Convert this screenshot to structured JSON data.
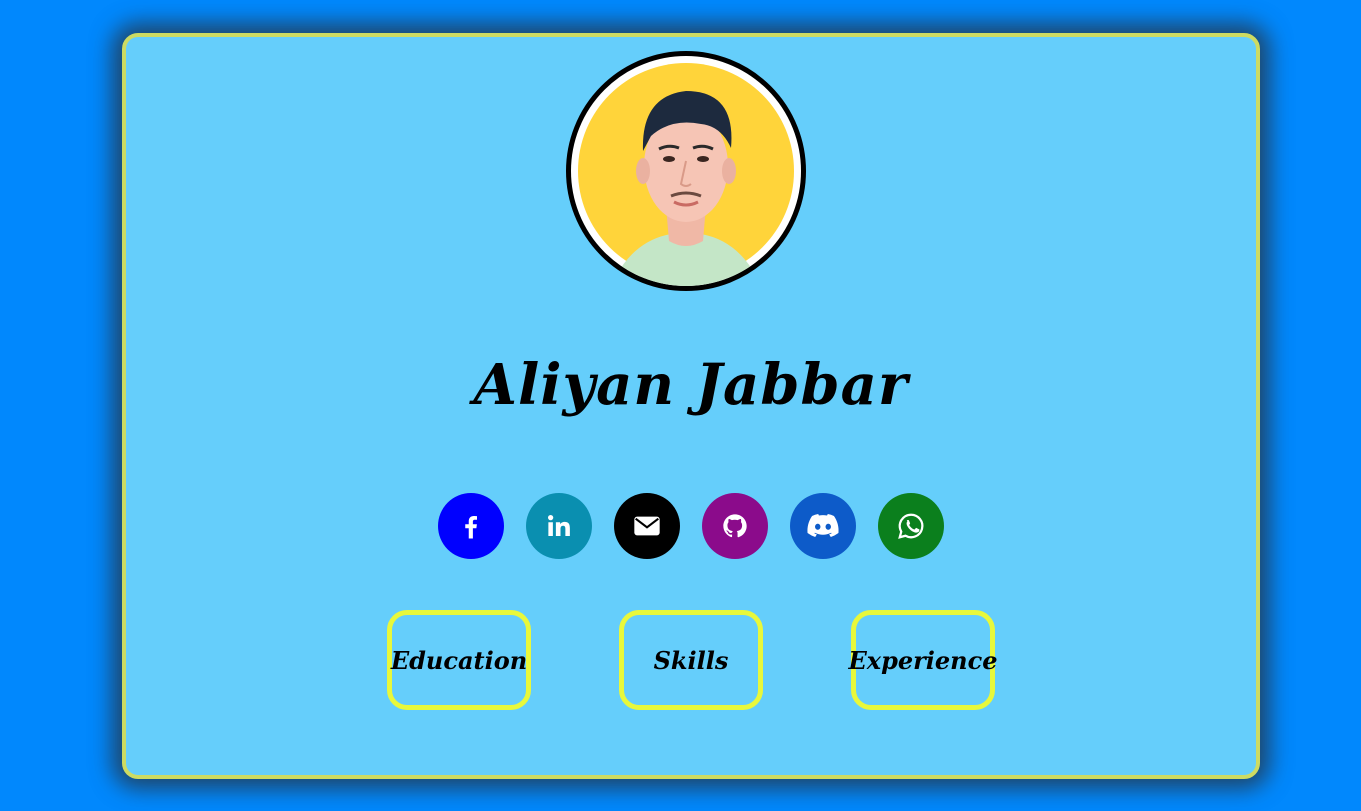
{
  "profile": {
    "name": "Aliyan Jabbar",
    "avatar_background": "#ffd43a"
  },
  "socials": [
    {
      "name": "facebook",
      "icon": "facebook-icon",
      "color": "#0000ff"
    },
    {
      "name": "linkedin",
      "icon": "linkedin-icon",
      "color": "#0a8fb0"
    },
    {
      "name": "email",
      "icon": "envelope-icon",
      "color": "#000000"
    },
    {
      "name": "github",
      "icon": "github-icon",
      "color": "#8b0b8b"
    },
    {
      "name": "discord",
      "icon": "discord-icon",
      "color": "#0d5bc9"
    },
    {
      "name": "whatsapp",
      "icon": "whatsapp-icon",
      "color": "#0b7f1d"
    }
  ],
  "nav": {
    "education_label": "Education",
    "skills_label": "Skills",
    "experience_label": "Experience"
  },
  "colors": {
    "page_background": "#0188fd",
    "card_background": "#65cefb",
    "card_border": "#cddb62",
    "button_border": "#e8f83b"
  }
}
